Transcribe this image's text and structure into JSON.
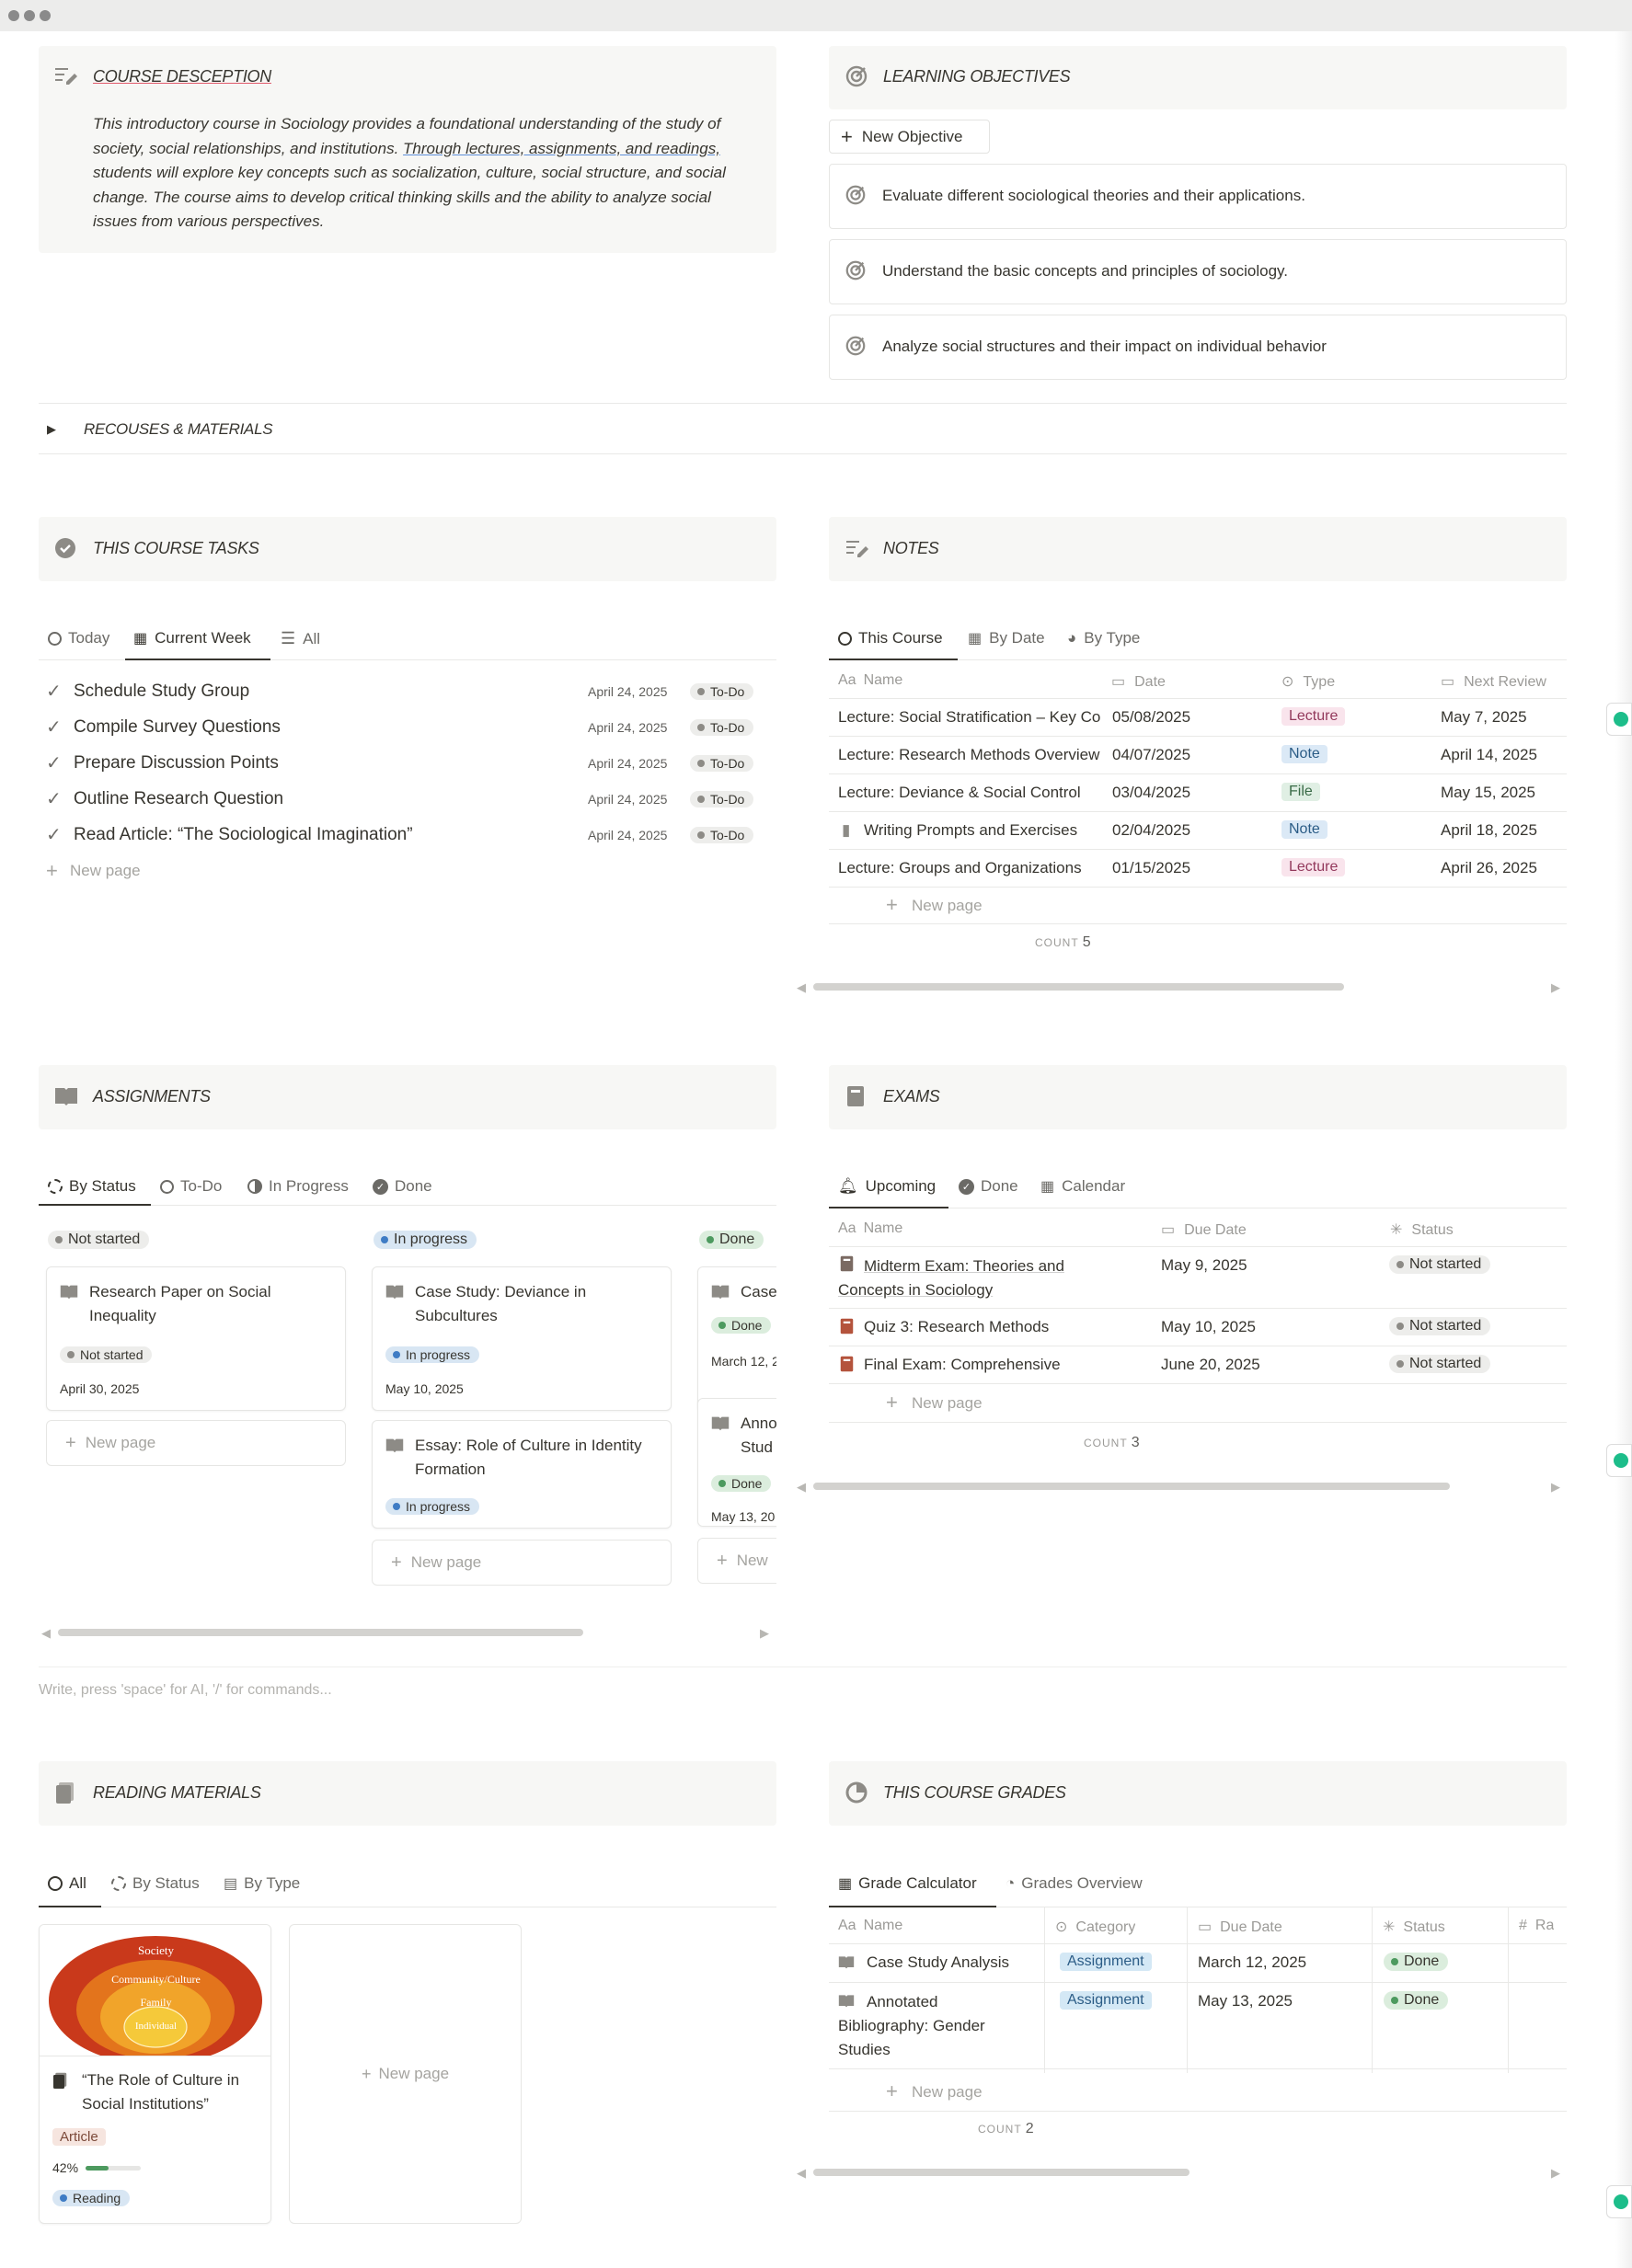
{
  "course_description": {
    "title": "COURSE DESCEPTION",
    "body_1": "This introductory course in Sociology provides a foundational understanding of the study of",
    "body_2a": "society, social relationships, and institutions. ",
    "body_2b": "Through lectures, assignments, and readings,",
    "body_3": "students will explore key concepts such as socialization, culture, social structure, and social",
    "body_4": "change. The course aims to develop critical thinking skills and the ability to analyze social",
    "body_5": "issues from various perspectives."
  },
  "learning_objectives": {
    "title": "LEARNING OBJECTIVES",
    "new_button": "New Objective",
    "items": [
      "Evaluate different sociological theories and their applications.",
      "Understand the basic concepts and principles of sociology.",
      "Analyze social structures and their impact on individual behavior"
    ]
  },
  "resources_toggle": "RECOUSES & MATERIALS",
  "tasks": {
    "title": "THIS COURSE TASKS",
    "tabs": [
      "Today",
      "Current Week",
      "All"
    ],
    "rows": [
      {
        "name": "Schedule Study Group",
        "date": "April 24, 2025",
        "status": "To-Do"
      },
      {
        "name": "Compile Survey Questions",
        "date": "April 24, 2025",
        "status": "To-Do"
      },
      {
        "name": "Prepare Discussion Points",
        "date": "April 24, 2025",
        "status": "To-Do"
      },
      {
        "name": "Outline Research Question",
        "date": "April 24, 2025",
        "status": "To-Do"
      },
      {
        "name": "Read Article: “The Sociological Imagination”",
        "date": "April 24, 2025",
        "status": "To-Do"
      }
    ],
    "new_page": "New page"
  },
  "notes": {
    "title": "NOTES",
    "tabs": [
      "This Course",
      "By Date",
      "By Type"
    ],
    "columns": [
      "Name",
      "Date",
      "Type",
      "Next Review"
    ],
    "rows": [
      {
        "name": "Lecture: Social Stratification – Key Co",
        "date": "05/08/2025",
        "type": "Lecture",
        "review": "May 7, 2025"
      },
      {
        "name": "Lecture: Research Methods Overview",
        "date": "04/07/2025",
        "type": "Note",
        "review": "April 14, 2025"
      },
      {
        "name": "Lecture: Deviance & Social Control",
        "date": "03/04/2025",
        "type": "File",
        "review": "May 15, 2025"
      },
      {
        "name": "Writing Prompts and Exercises",
        "date": "02/04/2025",
        "type": "Note",
        "review": "April 18, 2025"
      },
      {
        "name": "Lecture: Groups and Organizations",
        "date": "01/15/2025",
        "type": "Lecture",
        "review": "April 26, 2025"
      }
    ],
    "new_page": "New page",
    "count_label": "COUNT",
    "count": "5"
  },
  "assignments": {
    "title": "ASSIGNMENTS",
    "tabs": [
      "By Status",
      "To-Do",
      "In Progress",
      "Done"
    ],
    "groups": [
      {
        "label": "Not started",
        "cards": [
          {
            "title_1": "Research Paper on Social",
            "title_2": "Inequality",
            "status": "Not started",
            "date": "April 30, 2025"
          }
        ]
      },
      {
        "label": "In progress",
        "cards": [
          {
            "title_1": "Case Study: Deviance in",
            "title_2": "Subcultures",
            "status": "In progress",
            "date": "May 10, 2025"
          },
          {
            "title_1": "Essay: Role of Culture in Identity",
            "title_2": "Formation",
            "status": "In progress"
          }
        ]
      },
      {
        "label": "Done",
        "cards": [
          {
            "title_1": "Case",
            "status": "Done",
            "date": "March 12, 2"
          },
          {
            "title_1": "Anno",
            "title_2": "Stud",
            "status": "Done",
            "date": "May 13, 20"
          }
        ]
      }
    ],
    "new_page": "New page",
    "new_short": "New"
  },
  "exams": {
    "title": "EXAMS",
    "tabs": [
      "Upcoming",
      "Done",
      "Calendar"
    ],
    "columns": [
      "Name",
      "Due Date",
      "Status"
    ],
    "rows": [
      {
        "name_1": "Midterm Exam: Theories and",
        "name_2": "Concepts in Sociology",
        "due": "May 9, 2025",
        "status": "Not started"
      },
      {
        "name_1": "Quiz 3: Research Methods",
        "due": "May 10, 2025",
        "status": "Not started"
      },
      {
        "name_1": "Final Exam: Comprehensive",
        "due": "June 20, 2025",
        "status": "Not started"
      }
    ],
    "new_page": "New page",
    "count_label": "COUNT",
    "count": "3"
  },
  "editor_placeholder": "Write, press 'space' for AI, '/' for commands...",
  "reading": {
    "title": "READING MATERIALS",
    "tabs": [
      "All",
      "By Status",
      "By Type"
    ],
    "card": {
      "rings": [
        "Society",
        "Community/Culture",
        "Family",
        "Individual"
      ],
      "title_1": "“The Role of Culture in",
      "title_2": "Social Institutions”",
      "type": "Article",
      "progress_label": "42%",
      "progress": 0.42,
      "status": "Reading"
    },
    "new_page": "New page"
  },
  "grades": {
    "title": "THIS COURSE GRADES",
    "tabs": [
      "Grade Calculator",
      "Grades Overview"
    ],
    "columns": [
      "Name",
      "Category",
      "Due Date",
      "Status",
      "Ra"
    ],
    "rows": [
      {
        "name_1": "Case Study Analysis",
        "category": "Assignment",
        "due": "March 12, 2025",
        "status": "Done"
      },
      {
        "name_1": "Annotated",
        "name_2": "Bibliography: Gender",
        "name_3": "Studies",
        "category": "Assignment",
        "due": "May 13, 2025",
        "status": "Done"
      }
    ],
    "new_page": "New page",
    "count_label": "COUNT",
    "count": "2"
  },
  "colors": {
    "lecture_bg": "#f9e4ec",
    "lecture_fg": "#93395c",
    "note_bg": "#dbe9f6",
    "note_fg": "#2b5c86",
    "file_bg": "#e0efe4",
    "file_fg": "#3a6b47",
    "todo_bg": "#ededeb",
    "inprog_bg": "#d8e6f3",
    "done_bg": "#dbeddd",
    "assignment_bg": "#d4e8f5",
    "article_bg": "#f6e5df"
  }
}
